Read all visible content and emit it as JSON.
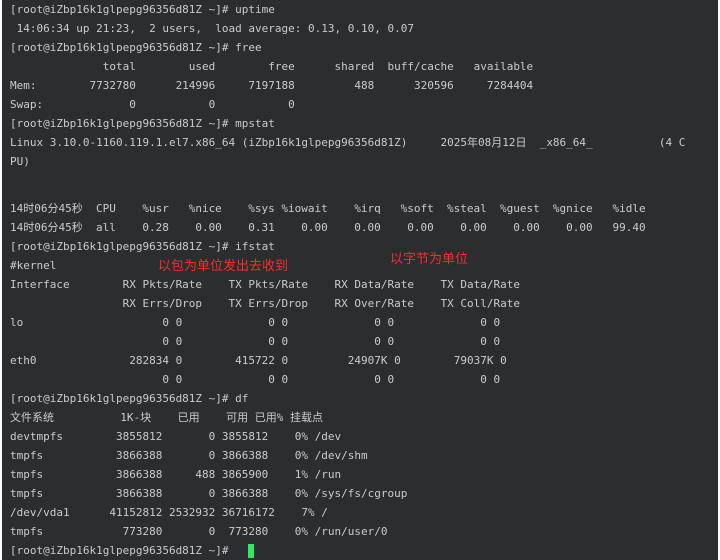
{
  "terminal": {
    "lines": [
      "[root@iZbp16k1glpepg96356d81Z ~]# uptime",
      " 14:06:34 up 21:23,  2 users,  load average: 0.13, 0.10, 0.07",
      "[root@iZbp16k1glpepg96356d81Z ~]# free",
      "              total        used        free      shared  buff/cache   available",
      "Mem:        7732780      214996     7197188         488      320596     7284404",
      "Swap:             0           0           0",
      "[root@iZbp16k1glpepg96356d81Z ~]# mpstat",
      "Linux 3.10.0-1160.119.1.el7.x86_64 (iZbp16k1glpepg96356d81Z)     2025年08月12日  _x86_64_          (4 C",
      "PU)",
      "",
      "14时06分45秒  CPU    %usr   %nice    %sys %iowait    %irq   %soft  %steal  %guest  %gnice   %idle",
      "14时06分45秒  all    0.28    0.00    0.31    0.00    0.00    0.00    0.00    0.00    0.00   99.40",
      "[root@iZbp16k1glpepg96356d81Z ~]# ifstat",
      "#kernel",
      "Interface        RX Pkts/Rate    TX Pkts/Rate    RX Data/Rate    TX Data/Rate",
      "                 RX Errs/Drop    TX Errs/Drop    RX Over/Rate    TX Coll/Rate",
      "lo                     0 0             0 0             0 0             0 0",
      "                       0 0             0 0             0 0             0 0",
      "eth0              282834 0        415722 0         24907K 0        79037K 0",
      "                       0 0             0 0             0 0             0 0",
      "[root@iZbp16k1glpepg96356d81Z ~]# df",
      "文件系统          1K-块    已用    可用 已用% 挂载点",
      "devtmpfs        3855812       0 3855812    0% /dev",
      "tmpfs           3866388       0 3866388    0% /dev/shm",
      "tmpfs           3866388     488 3865900    1% /run",
      "tmpfs           3866388       0 3866388    0% /sys/fs/cgroup",
      "/dev/vda1      41152812 2532932 36716172    7% /",
      "tmpfs            773280       0  773280    0% /run/user/0",
      "[root@iZbp16k1glpepg96356d81Z ~]# "
    ]
  },
  "annotations": {
    "packets_note": "以包为单位发出去收到",
    "bytes_note": "以字节为单位"
  },
  "colors": {
    "background": "#2b2d2f",
    "text": "#c9ccce",
    "annotation": "#ff2a2a",
    "cursor": "#2ee86a"
  }
}
